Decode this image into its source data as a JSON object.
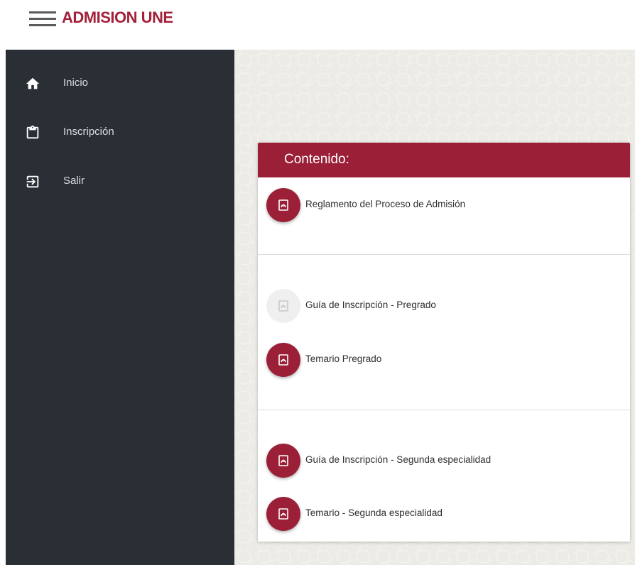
{
  "header": {
    "title": "ADMISION UNE",
    "menu_icon": "hamburger-menu-icon",
    "brand_color": "#a3213a"
  },
  "sidebar": {
    "background": "#2a2f36",
    "items": [
      {
        "label": "Inicio",
        "icon": "home-icon"
      },
      {
        "label": "Inscripción",
        "icon": "clipboard-icon"
      },
      {
        "label": "Salir",
        "icon": "exit-icon"
      }
    ]
  },
  "content": {
    "title": "Contenido:",
    "accent": "#9a1f37",
    "sections": [
      {
        "documents": [
          {
            "label": "Reglamento del Proceso de Admisión",
            "icon": "pdf-icon",
            "enabled": true
          }
        ]
      },
      {
        "documents": [
          {
            "label": "Guía de Inscripción - Pregrado",
            "icon": "pdf-icon",
            "enabled": false
          },
          {
            "label": "Temario Pregrado",
            "icon": "pdf-icon",
            "enabled": true
          }
        ]
      },
      {
        "documents": [
          {
            "label": "Guía de Inscripción - Segunda especialidad",
            "icon": "pdf-icon",
            "enabled": true
          },
          {
            "label": "Temario - Segunda especialidad",
            "icon": "pdf-icon",
            "enabled": true
          }
        ]
      }
    ]
  }
}
